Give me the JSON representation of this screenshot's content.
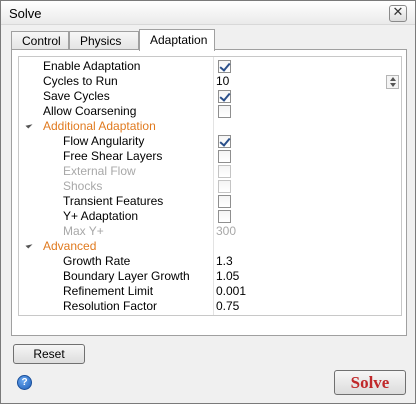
{
  "window": {
    "title": "Solve",
    "close_glyph": "✕"
  },
  "tabs": [
    {
      "label": "Control",
      "active": false
    },
    {
      "label": "Physics",
      "active": false
    },
    {
      "label": "Adaptation",
      "active": true
    }
  ],
  "properties": {
    "enable_adaptation": {
      "label": "Enable Adaptation",
      "checked": true
    },
    "cycles_to_run": {
      "label": "Cycles to Run",
      "value": "10"
    },
    "save_cycles": {
      "label": "Save Cycles",
      "checked": true
    },
    "allow_coarsening": {
      "label": "Allow Coarsening",
      "checked": false
    },
    "additional_adaptation": {
      "label": "Additional Adaptation"
    },
    "flow_angularity": {
      "label": "Flow Angularity",
      "checked": true
    },
    "free_shear_layers": {
      "label": "Free Shear Layers",
      "checked": false
    },
    "external_flow": {
      "label": "External Flow",
      "checked": false,
      "disabled": true
    },
    "shocks": {
      "label": "Shocks",
      "checked": false,
      "disabled": true
    },
    "transient_features": {
      "label": "Transient Features",
      "checked": false
    },
    "y_plus_adaptation": {
      "label": "Y+ Adaptation",
      "checked": false
    },
    "max_y_plus": {
      "label": "Max Y+",
      "value": "300",
      "disabled": true
    },
    "advanced": {
      "label": "Advanced"
    },
    "growth_rate": {
      "label": "Growth Rate",
      "value": "1.3"
    },
    "boundary_layer_growth": {
      "label": "Boundary Layer Growth",
      "value": "1.05"
    },
    "refinement_limit": {
      "label": "Refinement Limit",
      "value": "0.001"
    },
    "resolution_factor": {
      "label": "Resolution Factor",
      "value": "0.75"
    }
  },
  "buttons": {
    "reset": "Reset",
    "solve": "Solve",
    "help_glyph": "?"
  },
  "colors": {
    "section_header": "#e07a1f",
    "solve_text": "#c0282a",
    "disabled_text": "#a8a8a8"
  }
}
